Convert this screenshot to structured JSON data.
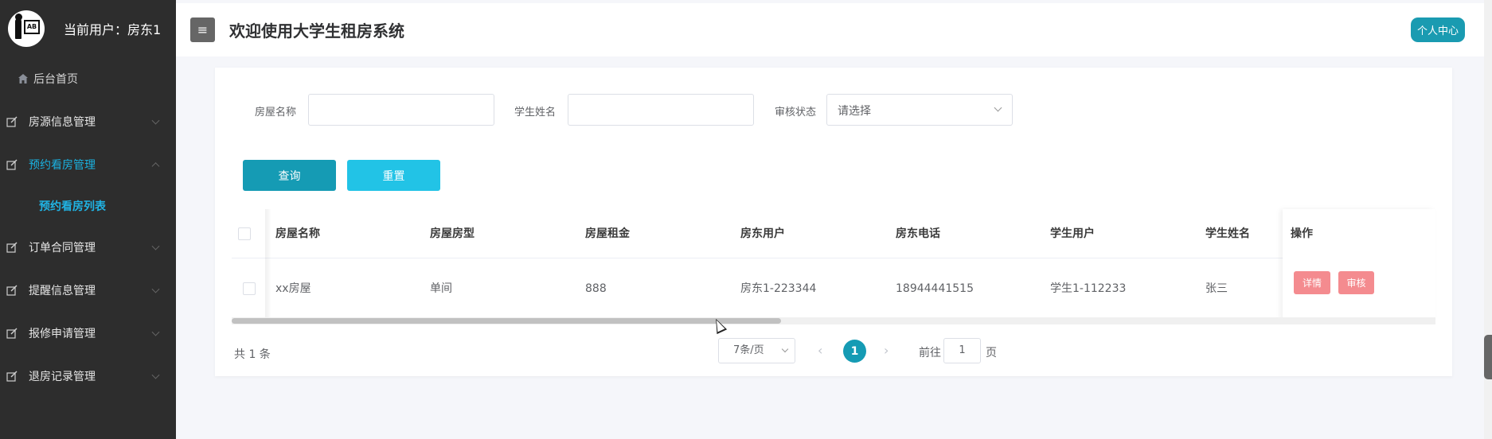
{
  "sidebar": {
    "user_label": "当前用户：房东1",
    "home": "后台首页",
    "items": [
      {
        "label": "房源信息管理"
      },
      {
        "label": "预约看房管理"
      },
      {
        "label": "订单合同管理"
      },
      {
        "label": "提醒信息管理"
      },
      {
        "label": "报修申请管理"
      },
      {
        "label": "退房记录管理"
      }
    ],
    "sub_item": "预约看房列表"
  },
  "header": {
    "toggle_icon": "≡",
    "title": "欢迎使用大学生租房系统",
    "profile_button": "个人中心"
  },
  "filters": {
    "house_name_label": "房屋名称",
    "house_name_value": "",
    "student_name_label": "学生姓名",
    "student_name_value": "",
    "audit_status_label": "审核状态",
    "audit_status_placeholder": "请选择"
  },
  "buttons": {
    "query": "查询",
    "reset": "重置"
  },
  "table": {
    "columns": [
      "房屋名称",
      "房屋房型",
      "房屋租金",
      "房东用户",
      "房东电话",
      "学生用户",
      "学生姓名",
      "操作"
    ],
    "rows": [
      {
        "cells": [
          "xx房屋",
          "单间",
          "888",
          "房东1-223344",
          "18944441515",
          "学生1-112233",
          "张三"
        ],
        "actions": [
          "详情",
          "审核"
        ]
      }
    ]
  },
  "pagination": {
    "total": "共 1 条",
    "page_size": "7条/页",
    "prev": "‹",
    "current_page": "1",
    "next": "›",
    "goto_label": "前往",
    "goto_value": "1",
    "goto_suffix": "页"
  },
  "colors": {
    "sidebar_bg": "#2d2d2d",
    "accent": "#159bb4",
    "reset": "#22c3e6",
    "danger_btn": "#f48b8f",
    "active_menu": "#1ab1e0"
  }
}
